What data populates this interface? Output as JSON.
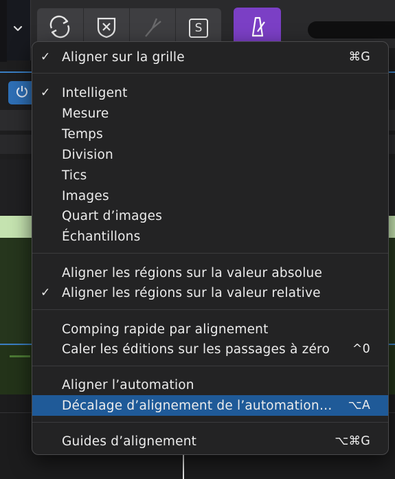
{
  "menu": {
    "items": [
      {
        "label": "Aligner sur la grille",
        "checked": true,
        "shortcut": "⌘G",
        "highlighted": false
      },
      {
        "label": "Intelligent",
        "checked": true,
        "shortcut": "",
        "highlighted": false
      },
      {
        "label": "Mesure",
        "checked": false,
        "shortcut": "",
        "highlighted": false
      },
      {
        "label": "Temps",
        "checked": false,
        "shortcut": "",
        "highlighted": false
      },
      {
        "label": "Division",
        "checked": false,
        "shortcut": "",
        "highlighted": false
      },
      {
        "label": "Tics",
        "checked": false,
        "shortcut": "",
        "highlighted": false
      },
      {
        "label": "Images",
        "checked": false,
        "shortcut": "",
        "highlighted": false
      },
      {
        "label": "Quart d’images",
        "checked": false,
        "shortcut": "",
        "highlighted": false
      },
      {
        "label": "Échantillons",
        "checked": false,
        "shortcut": "",
        "highlighted": false
      },
      {
        "label": "Aligner les régions sur la valeur absolue",
        "checked": false,
        "shortcut": "",
        "highlighted": false
      },
      {
        "label": "Aligner les régions sur la valeur relative",
        "checked": true,
        "shortcut": "",
        "highlighted": false
      },
      {
        "label": "Comping rapide par alignement",
        "checked": false,
        "shortcut": "",
        "highlighted": false
      },
      {
        "label": "Caler les éditions sur les passages à zéro",
        "checked": false,
        "shortcut": "^0",
        "highlighted": false
      },
      {
        "label": "Aligner l’automation",
        "checked": false,
        "shortcut": "",
        "highlighted": false
      },
      {
        "label": "Décalage d’alignement de l’automation…",
        "checked": false,
        "shortcut": "⌥A",
        "highlighted": true
      },
      {
        "label": "Guides d’alignement",
        "checked": false,
        "shortcut": "⌥⌘G",
        "highlighted": false
      }
    ],
    "check_glyph": "✓"
  },
  "toolbar": {
    "icons": [
      "chevron-down-icon",
      "cycle-icon",
      "replace-icon",
      "tuning-fork-icon",
      "solo-icon",
      "metronome-icon",
      "power-icon"
    ],
    "solo_label": "S"
  },
  "colors": {
    "menu_bg": "#232324",
    "highlight": "#1f5a98",
    "metronome_accent": "#7b3fc5",
    "blue_accent": "#3a7fc4",
    "region_green": "#c5e3b0"
  }
}
